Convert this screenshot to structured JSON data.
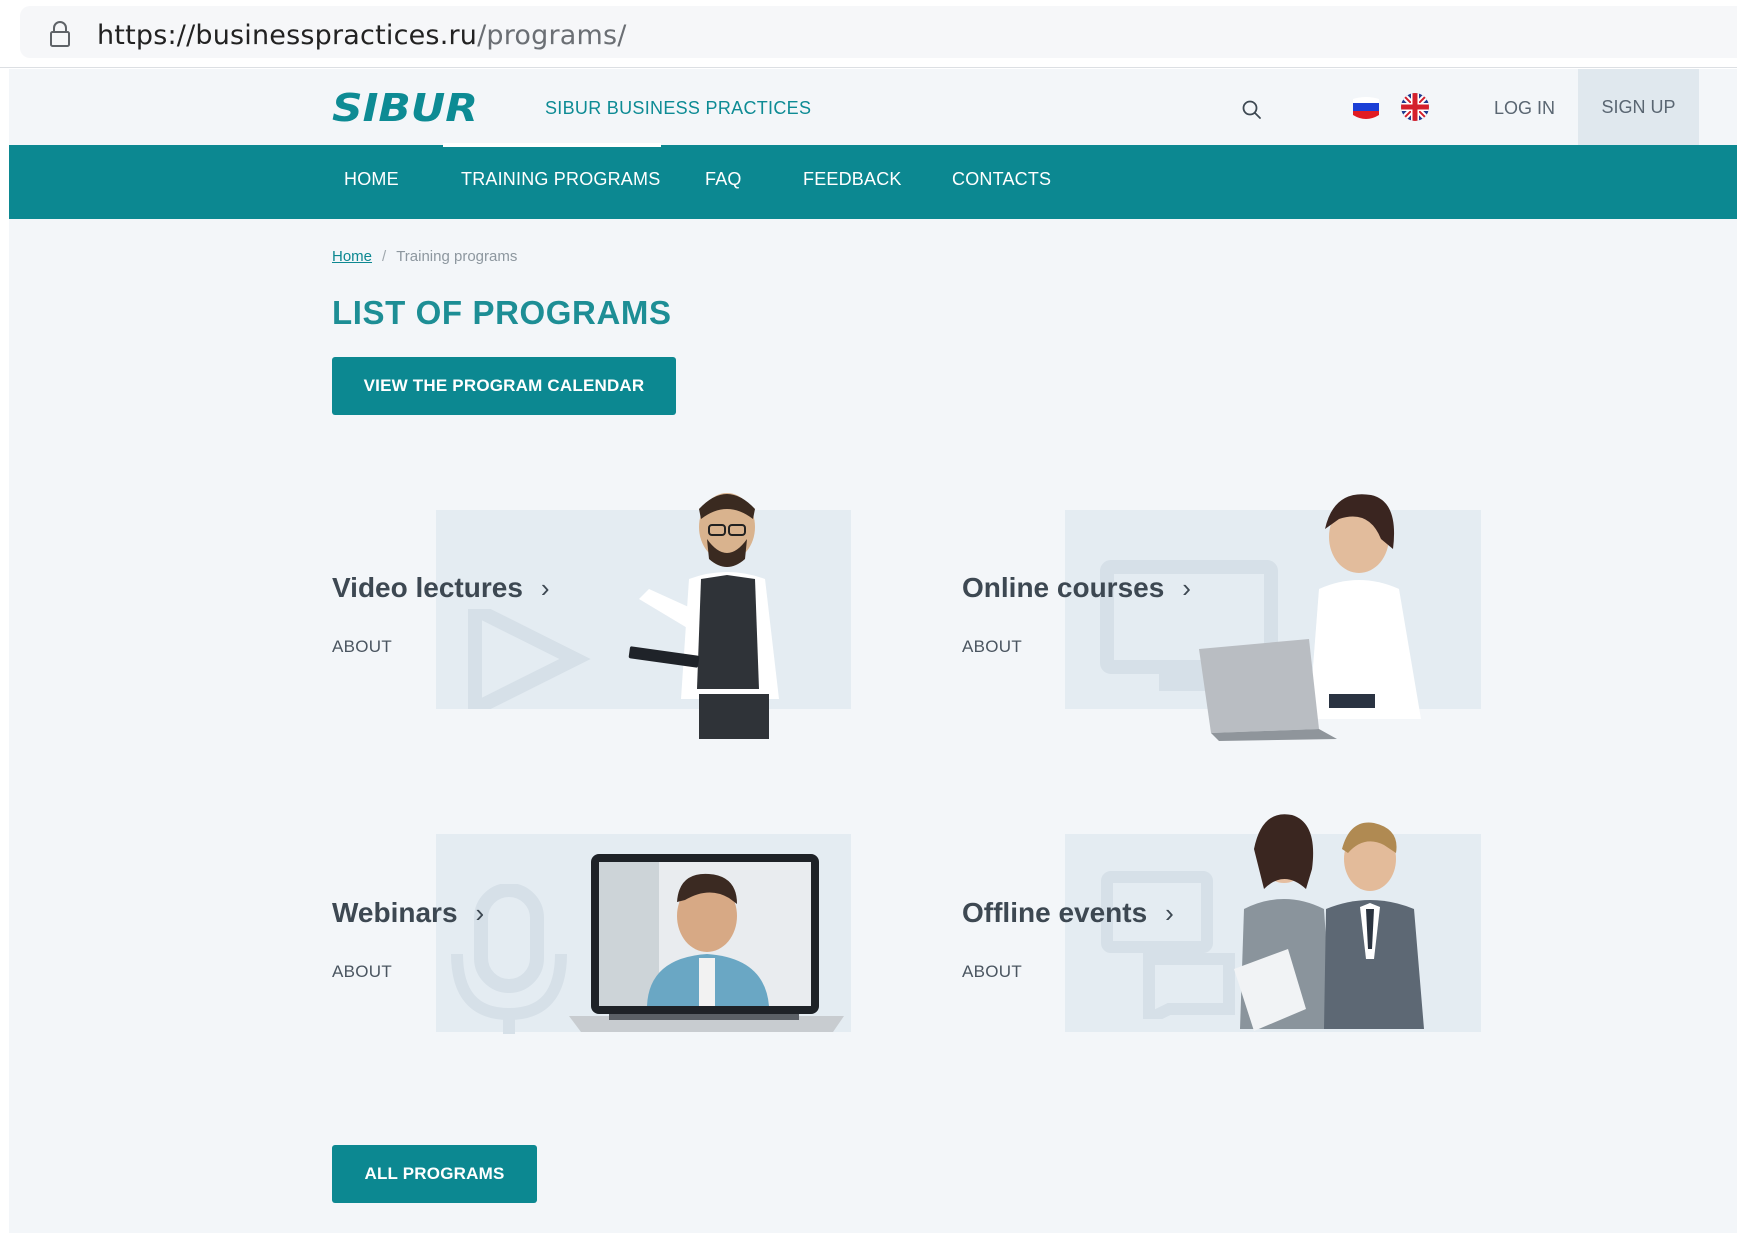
{
  "browser": {
    "url_host": "https://businesspractices.ru",
    "url_path": "/programs/"
  },
  "header": {
    "logo_text": "SIBUR",
    "site_name": "SIBUR BUSINESS PRACTICES",
    "login_label": "LOG IN",
    "signup_label": "SIGN UP"
  },
  "nav": {
    "items": [
      {
        "label": "HOME"
      },
      {
        "label": "TRAINING PROGRAMS"
      },
      {
        "label": "FAQ"
      },
      {
        "label": "FEEDBACK"
      },
      {
        "label": "CONTACTS"
      }
    ],
    "active_index": 1
  },
  "breadcrumb": {
    "home": "Home",
    "separator": "/",
    "current": "Training programs"
  },
  "page_title": "LIST OF PROGRAMS",
  "calendar_button": "VIEW THE PROGRAM CALENDAR",
  "cards": [
    {
      "title": "Video lectures",
      "about": "ABOUT",
      "icon": "play-icon"
    },
    {
      "title": "Online courses",
      "about": "ABOUT",
      "icon": "monitor-icon"
    },
    {
      "title": "Webinars",
      "about": "ABOUT",
      "icon": "microphone-icon"
    },
    {
      "title": "Offline events",
      "about": "ABOUT",
      "icon": "chat-icon"
    }
  ],
  "all_programs_button": "ALL PROGRAMS",
  "colors": {
    "brand_teal": "#0c8891",
    "page_bg": "#f3f6f9",
    "card_bg": "#e4ecf2",
    "heading": "#3d4852"
  }
}
